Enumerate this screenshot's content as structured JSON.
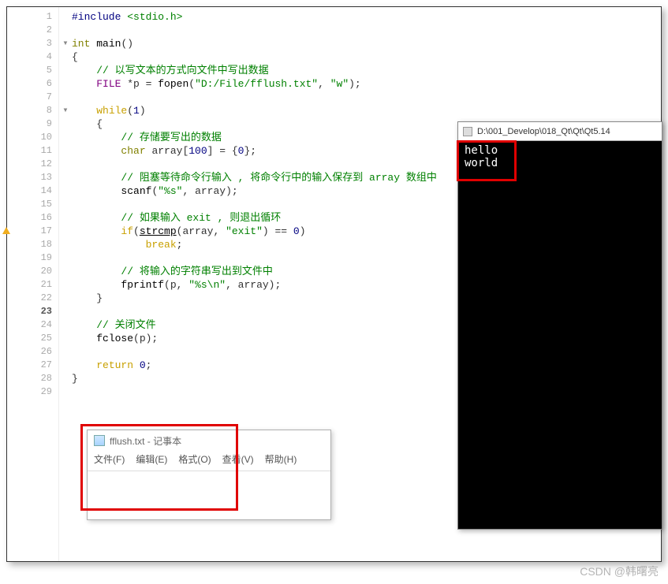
{
  "code": {
    "lines": [
      {
        "n": "1",
        "fold": "",
        "html": "<span class='pp'>#include</span> <span class='str'>&lt;stdio.h&gt;</span>"
      },
      {
        "n": "2",
        "fold": "",
        "html": ""
      },
      {
        "n": "3",
        "fold": "▾",
        "html": "<span class='kw2'>int</span> <span class='func'>main</span>()"
      },
      {
        "n": "4",
        "fold": "",
        "html": "{"
      },
      {
        "n": "5",
        "fold": "",
        "html": "    <span class='cmt'>// 以写文本的方式向文件中写出数据</span>"
      },
      {
        "n": "6",
        "fold": "",
        "html": "    <span class='type'>FILE</span> *p = <span class='func'>fopen</span>(<span class='str'>\"D:/File/fflush.txt\"</span>, <span class='str'>\"w\"</span>);"
      },
      {
        "n": "7",
        "fold": "",
        "html": ""
      },
      {
        "n": "8",
        "fold": "▾",
        "html": "    <span class='kw'>while</span>(<span class='num'>1</span>)"
      },
      {
        "n": "9",
        "fold": "",
        "html": "    {"
      },
      {
        "n": "10",
        "fold": "",
        "html": "        <span class='cmt'>// 存储要写出的数据</span>"
      },
      {
        "n": "11",
        "fold": "",
        "html": "        <span class='kw2'>char</span> array[<span class='num'>100</span>] = {<span class='num'>0</span>};"
      },
      {
        "n": "12",
        "fold": "",
        "html": ""
      },
      {
        "n": "13",
        "fold": "",
        "html": "        <span class='cmt'>// 阻塞等待命令行输入 , 将命令行中的输入保存到 array 数组中</span>"
      },
      {
        "n": "14",
        "fold": "",
        "html": "        <span class='func'>scanf</span>(<span class='str'>\"%s\"</span>, array);"
      },
      {
        "n": "15",
        "fold": "",
        "html": ""
      },
      {
        "n": "16",
        "fold": "",
        "html": "        <span class='cmt'>// 如果输入 exit , 则退出循环</span>"
      },
      {
        "n": "17",
        "fold": "",
        "warn": true,
        "html": "        <span class='kw'>if</span>(<span class='func underline'>strcmp</span>(array, <span class='str'>\"exit\"</span>) == <span class='num'>0</span>)"
      },
      {
        "n": "18",
        "fold": "",
        "html": "            <span class='kw'>break</span>;"
      },
      {
        "n": "19",
        "fold": "",
        "html": ""
      },
      {
        "n": "20",
        "fold": "",
        "html": "        <span class='cmt'>// 将输入的字符串写出到文件中</span>"
      },
      {
        "n": "21",
        "fold": "",
        "html": "        <span class='func'>fprintf</span>(p, <span class='str'>\"%s\\n\"</span>, array);"
      },
      {
        "n": "22",
        "fold": "",
        "html": "    }"
      },
      {
        "n": "23",
        "fold": "",
        "current": true,
        "html": ""
      },
      {
        "n": "24",
        "fold": "",
        "html": "    <span class='cmt'>// 关闭文件</span>"
      },
      {
        "n": "25",
        "fold": "",
        "html": "    <span class='func'>fclose</span>(p);"
      },
      {
        "n": "26",
        "fold": "",
        "html": ""
      },
      {
        "n": "27",
        "fold": "",
        "html": "    <span class='kw'>return</span> <span class='num'>0</span>;"
      },
      {
        "n": "28",
        "fold": "",
        "html": "}"
      },
      {
        "n": "29",
        "fold": "",
        "html": ""
      }
    ]
  },
  "notepad": {
    "title": "fflush.txt - 记事本",
    "menu": [
      "文件(F)",
      "编辑(E)",
      "格式(O)",
      "查看(V)",
      "帮助(H)"
    ],
    "content": ""
  },
  "console": {
    "title": "D:\\001_Develop\\018_Qt\\Qt\\Qt5.14",
    "output": "hello\nworld"
  },
  "watermark": "CSDN @韩曙亮"
}
